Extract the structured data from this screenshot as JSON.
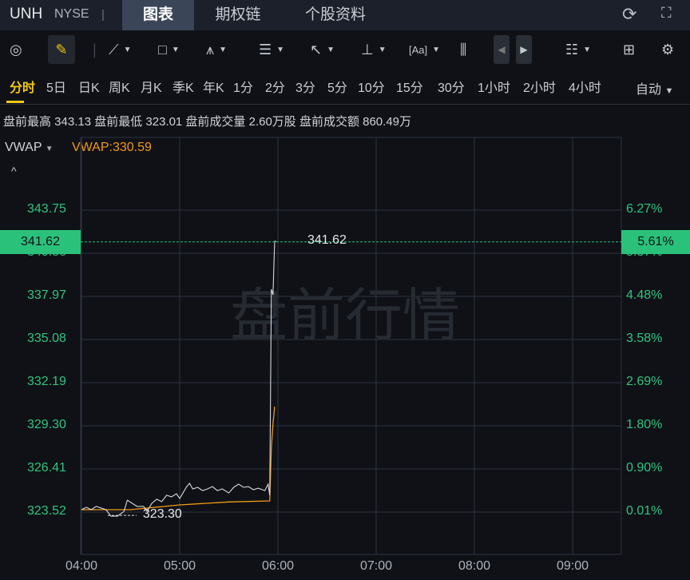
{
  "header": {
    "symbol": "UNH",
    "exchange": "NYSE",
    "separator": "|",
    "tabs": [
      "图表",
      "期权链",
      "个股资料"
    ],
    "active_tab": 0
  },
  "toolbar": {
    "icons": [
      "gauge-icon",
      "pen-icon",
      "line-tool-icon",
      "rectangle-tool-icon",
      "pattern-tool-icon",
      "fibonacci-tool-icon",
      "arrow-tool-icon",
      "range-tool-icon",
      "text-tool-icon",
      "candles-icon",
      "prev-icon",
      "next-icon",
      "layout-list-icon",
      "grid-icon",
      "gear-icon"
    ]
  },
  "periods": {
    "items": [
      "分时",
      "5日",
      "日K",
      "周K",
      "月K",
      "季K",
      "年K",
      "1分",
      "2分",
      "3分",
      "5分",
      "10分",
      "15分",
      "30分",
      "1小时",
      "2小时",
      "4小时"
    ],
    "active": 0,
    "mode": "自动"
  },
  "stats": "盘前最高 343.13 盘前最低 323.01 盘前成交量 2.60万股 盘前成交额 860.49万",
  "indicator": {
    "name": "VWAP",
    "value_label": "VWAP:330.59"
  },
  "chart_data": {
    "type": "line",
    "watermark": "盘前行情",
    "y_ticks": [
      "343.75",
      "340.86",
      "337.97",
      "335.08",
      "332.19",
      "329.30",
      "326.41",
      "323.52"
    ],
    "pct_ticks": [
      "6.27%",
      "5.37%",
      "4.48%",
      "3.58%",
      "2.69%",
      "1.80%",
      "0.90%",
      "0.01%"
    ],
    "ylim": [
      323.52,
      343.75
    ],
    "x_ticks": [
      "04:00",
      "05:00",
      "06:00",
      "07:00",
      "08:00",
      "09:00"
    ],
    "current": {
      "price": "341.62",
      "pct": "5.61%",
      "value": 341.62
    },
    "low_label": {
      "text": "323.30",
      "value": 323.3,
      "minute": 18
    },
    "price": {
      "minutes": [
        0,
        3,
        6,
        9,
        12,
        15,
        18,
        22,
        26,
        28,
        31,
        34,
        38,
        40,
        43,
        46,
        49,
        52,
        55,
        58,
        60,
        62,
        64,
        66,
        68,
        71,
        74,
        77,
        80,
        83,
        86,
        90,
        93,
        96,
        99,
        102,
        105,
        108,
        112,
        114,
        115,
        116,
        117,
        118,
        119
      ],
      "values": [
        323.68,
        323.84,
        323.68,
        323.9,
        323.79,
        323.68,
        323.25,
        323.25,
        323.57,
        324.32,
        324.11,
        323.9,
        323.9,
        323.57,
        324.11,
        324.38,
        324.22,
        324.65,
        324.54,
        324.75,
        324.43,
        324.8,
        325.18,
        325.45,
        325.07,
        325.18,
        324.96,
        325.07,
        325.23,
        324.96,
        325.07,
        324.8,
        325.18,
        325.39,
        325.18,
        325.23,
        325.02,
        325.12,
        324.96,
        325.39,
        324.65,
        338.45,
        338.08,
        341.66,
        341.66
      ]
    },
    "vwap": {
      "minutes": [
        0,
        30,
        60,
        90,
        115,
        116,
        117,
        118
      ],
      "values": [
        323.68,
        323.68,
        324.0,
        324.2,
        324.27,
        327.86,
        329.46,
        330.59
      ]
    }
  }
}
